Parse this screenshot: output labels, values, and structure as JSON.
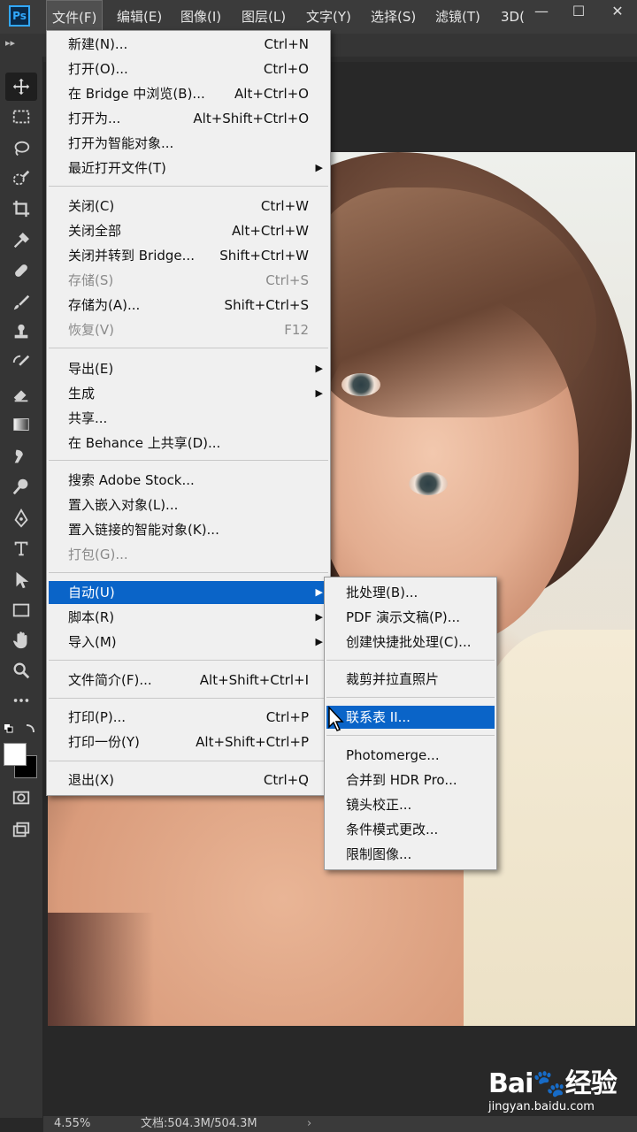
{
  "app": {
    "logo": "Ps"
  },
  "menubar": {
    "items": [
      "文件(F)",
      "编辑(E)",
      "图像(I)",
      "图层(L)",
      "文字(Y)",
      "选择(S)",
      "滤镜(T)",
      "3D("
    ],
    "window_controls": [
      "—",
      "☐",
      "✕"
    ]
  },
  "file_menu": {
    "items": [
      {
        "label": "新建(N)...",
        "shortcut": "Ctrl+N"
      },
      {
        "label": "打开(O)...",
        "shortcut": "Ctrl+O"
      },
      {
        "label": "在 Bridge 中浏览(B)...",
        "shortcut": "Alt+Ctrl+O"
      },
      {
        "label": "打开为...",
        "shortcut": "Alt+Shift+Ctrl+O"
      },
      {
        "label": "打开为智能对象...",
        "shortcut": ""
      },
      {
        "label": "最近打开文件(T)",
        "shortcut": ""
      },
      {
        "label": "关闭(C)",
        "shortcut": "Ctrl+W"
      },
      {
        "label": "关闭全部",
        "shortcut": "Alt+Ctrl+W"
      },
      {
        "label": "关闭并转到 Bridge...",
        "shortcut": "Shift+Ctrl+W"
      },
      {
        "label": "存储(S)",
        "shortcut": "Ctrl+S"
      },
      {
        "label": "存储为(A)...",
        "shortcut": "Shift+Ctrl+S"
      },
      {
        "label": "恢复(V)",
        "shortcut": "F12"
      },
      {
        "label": "导出(E)",
        "shortcut": ""
      },
      {
        "label": "生成",
        "shortcut": ""
      },
      {
        "label": "共享...",
        "shortcut": ""
      },
      {
        "label": "在 Behance 上共享(D)...",
        "shortcut": ""
      },
      {
        "label": "搜索 Adobe Stock...",
        "shortcut": ""
      },
      {
        "label": "置入嵌入对象(L)...",
        "shortcut": ""
      },
      {
        "label": "置入链接的智能对象(K)...",
        "shortcut": ""
      },
      {
        "label": "打包(G)...",
        "shortcut": ""
      },
      {
        "label": "自动(U)",
        "shortcut": ""
      },
      {
        "label": "脚本(R)",
        "shortcut": ""
      },
      {
        "label": "导入(M)",
        "shortcut": ""
      },
      {
        "label": "文件简介(F)...",
        "shortcut": "Alt+Shift+Ctrl+I"
      },
      {
        "label": "打印(P)...",
        "shortcut": "Ctrl+P"
      },
      {
        "label": "打印一份(Y)",
        "shortcut": "Alt+Shift+Ctrl+P"
      },
      {
        "label": "退出(X)",
        "shortcut": "Ctrl+Q"
      }
    ]
  },
  "automate_submenu": {
    "items": [
      {
        "label": "批处理(B)..."
      },
      {
        "label": "PDF 演示文稿(P)..."
      },
      {
        "label": "创建快捷批处理(C)..."
      },
      {
        "label": "裁剪并拉直照片"
      },
      {
        "label": "联系表 II..."
      },
      {
        "label": "Photomerge..."
      },
      {
        "label": "合并到 HDR Pro..."
      },
      {
        "label": "镜头校正..."
      },
      {
        "label": "条件模式更改..."
      },
      {
        "label": "限制图像..."
      }
    ]
  },
  "statusbar": {
    "zoom": "4.55%",
    "doc": "文档:504.3M/504.3M",
    "arrow": "›"
  },
  "watermark": {
    "logo": "Bai🐾经验",
    "sub": "jingyan.baidu.com"
  },
  "colors": {
    "highlight": "#0a64c8",
    "menu_bg": "#f0f0f0",
    "app_bg": "#282828"
  }
}
